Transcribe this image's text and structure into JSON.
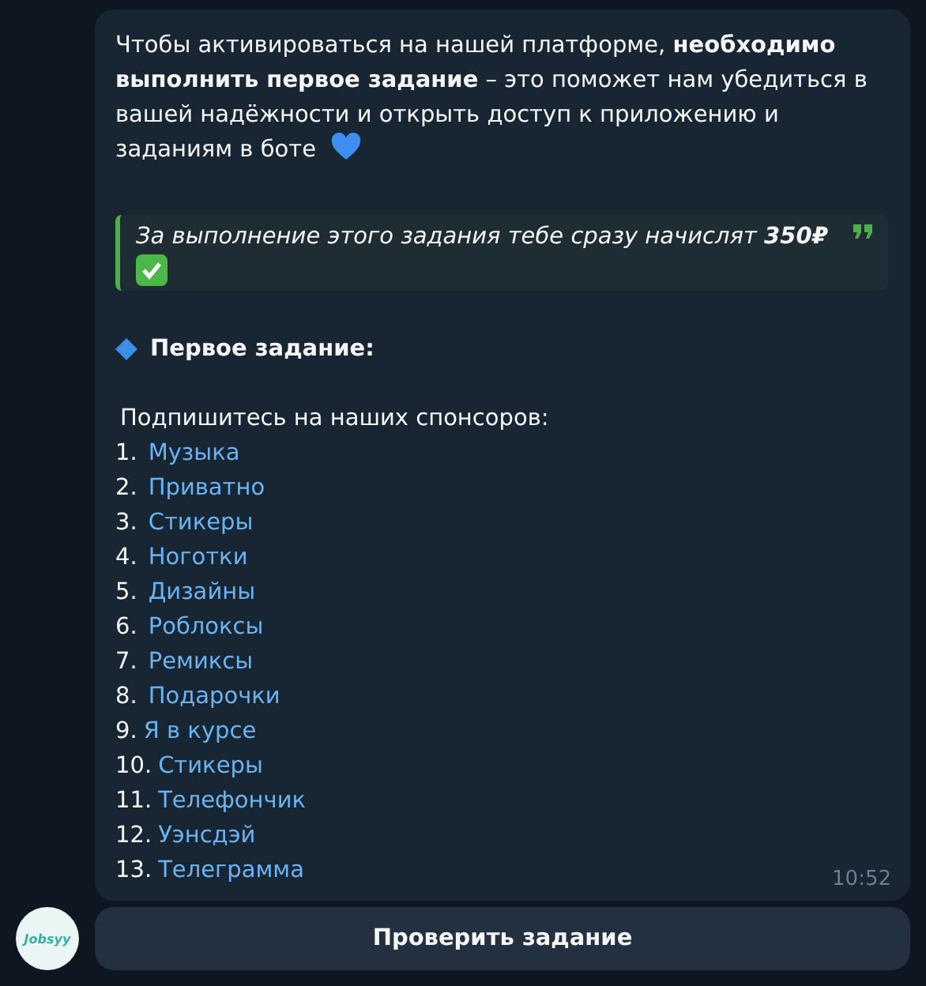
{
  "message": {
    "intro": "Чтобы активироваться на нашей платформе, **необходимо выполнить первое задание** – это поможет нам убедиться в вашей надёжности и открыть доступ к приложению и заданиям в боте",
    "quote": "За выполнение этого задания тебе сразу начислят **350₽**",
    "heading": "Первое задание:",
    "subscribe": "Подпишитесь на наших спонсоров:",
    "sponsors": [
      {
        "number": "1.",
        "name": "Музыка"
      },
      {
        "number": "2.",
        "name": "Приватно"
      },
      {
        "number": "3.",
        "name": "Стикеры"
      },
      {
        "number": "4.",
        "name": "Ноготки"
      },
      {
        "number": "5.",
        "name": "Дизайны"
      },
      {
        "number": "6.",
        "name": "Роблоксы"
      },
      {
        "number": "7.",
        "name": "Ремиксы"
      },
      {
        "number": "8.",
        "name": "Подарочки"
      },
      {
        "number": "9.",
        "name": "Я в курсе"
      },
      {
        "number": "10.",
        "name": "Стикеры"
      },
      {
        "number": "11.",
        "name": "Телефончик"
      },
      {
        "number": "12.",
        "name": "Уэнсдэй"
      },
      {
        "number": "13.",
        "name": "Телеграмма"
      }
    ],
    "time": "10:52"
  },
  "avatar": {
    "text": "Jobsyy"
  },
  "button": {
    "label": "Проверить задание"
  }
}
